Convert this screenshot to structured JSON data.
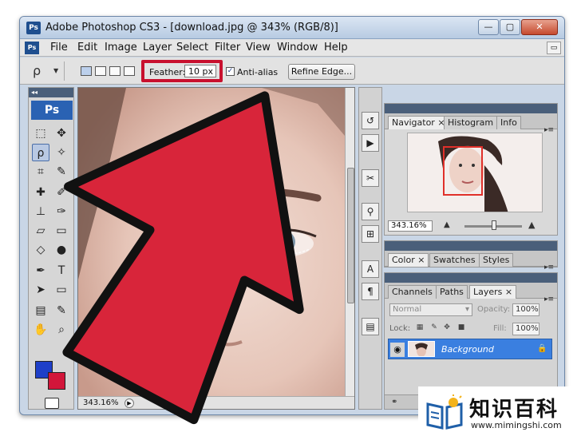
{
  "window": {
    "title": "Adobe Photoshop CS3 - [download.jpg @ 343% (RGB/8)]",
    "app_icon": "Ps",
    "min_glyph": "—",
    "max_glyph": "▢",
    "close_glyph": "✕"
  },
  "menu": {
    "ps_icon": "Ps",
    "items": [
      "File",
      "Edit",
      "Image",
      "Layer",
      "Select",
      "Filter",
      "View",
      "Window",
      "Help"
    ],
    "restore_glyph": "▭"
  },
  "options": {
    "feather_label": "Feather:",
    "feather_value": "10 px",
    "antialias_label": "Anti-alias",
    "antialias_checked": true,
    "refine_edge_label": "Refine Edge..."
  },
  "toolbox": {
    "logo": "Ps",
    "foreground_color": "#1e3fc8",
    "background_color": "#d2163a"
  },
  "document": {
    "zoom": "343.16%"
  },
  "navigator": {
    "tabs": [
      "Navigator",
      "Histogram",
      "Info"
    ],
    "zoom": "343.16%"
  },
  "color_panel": {
    "tabs": [
      "Color",
      "Swatches",
      "Styles"
    ]
  },
  "layers_panel": {
    "tabs": [
      "Channels",
      "Paths",
      "Layers"
    ],
    "blend_mode": "Normal",
    "opacity_label": "Opacity:",
    "opacity_value": "100%",
    "lock_label": "Lock:",
    "fill_label": "Fill:",
    "fill_value": "100%",
    "layer_name": "Background"
  },
  "watermark": {
    "title": "知识百科",
    "url": "www.mimingshi.com"
  },
  "colors": {
    "accent_red": "#c8102e",
    "selection_blue": "#3a7fe0"
  }
}
